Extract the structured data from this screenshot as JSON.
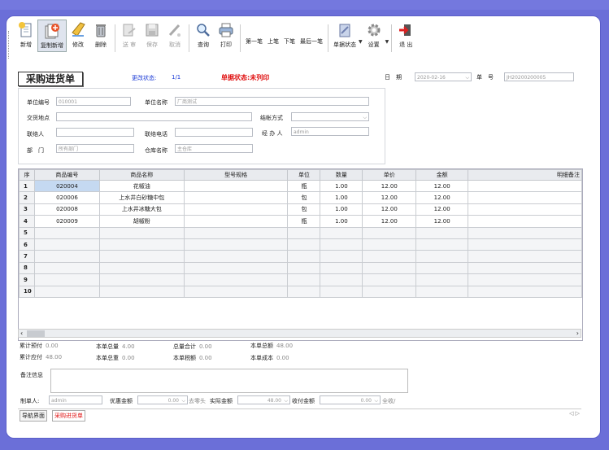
{
  "toolbar": {
    "new": "新增",
    "copy_new": "复制新增",
    "edit": "修改",
    "delete": "删除",
    "send_review": "送 审",
    "save": "保存",
    "cancel": "取消",
    "query": "查询",
    "print": "打印",
    "first": "第一笔",
    "prev": "上笔",
    "next": "下笔",
    "last": "最后一笔",
    "doc_status": "单据状态",
    "settings": "设置",
    "exit": "退 出"
  },
  "form": {
    "title": "采购进货单",
    "change_status_label": "更改状态:",
    "change_status_value": "1/1",
    "doc_status": "单据状态:未列印",
    "date_label": "日　期",
    "date_value": "2020-02-16",
    "number_label": "单　号",
    "number_value": "JH20200200005",
    "unit_code_label": "单位编号",
    "unit_code_value": "010001",
    "unit_name_label": "单位名称",
    "unit_name_value": "厂商测试",
    "delivery_label": "交货地点",
    "delivery_value": "",
    "settle_label": "结帐方式",
    "settle_value": "",
    "contact_label": "联络人",
    "contact_value": "",
    "phone_label": "联络电话",
    "phone_value": "",
    "handler_label": "经 办 人",
    "handler_value": "admin",
    "dept_label": "部　门",
    "dept_value": "所有部门",
    "warehouse_label": "仓库名称",
    "warehouse_value": "主仓库"
  },
  "grid": {
    "columns": [
      "序",
      "商品编号",
      "商品名称",
      "型号规格",
      "单位",
      "数量",
      "单价",
      "金额",
      "明细备注"
    ],
    "rows": [
      [
        "1",
        "020004",
        "花椒油",
        "",
        "瓶",
        "1.00",
        "12.00",
        "12.00",
        ""
      ],
      [
        "2",
        "020006",
        "上水井白砂糖中包",
        "",
        "包",
        "1.00",
        "12.00",
        "12.00",
        ""
      ],
      [
        "3",
        "020008",
        "上水井冰糖大包",
        "",
        "包",
        "1.00",
        "12.00",
        "12.00",
        ""
      ],
      [
        "4",
        "020009",
        "胡椒粉",
        "",
        "瓶",
        "1.00",
        "12.00",
        "12.00",
        ""
      ],
      [
        "5",
        "",
        "",
        "",
        "",
        "",
        "",
        "",
        ""
      ],
      [
        "6",
        "",
        "",
        "",
        "",
        "",
        "",
        "",
        ""
      ],
      [
        "7",
        "",
        "",
        "",
        "",
        "",
        "",
        "",
        ""
      ],
      [
        "8",
        "",
        "",
        "",
        "",
        "",
        "",
        "",
        ""
      ],
      [
        "9",
        "",
        "",
        "",
        "",
        "",
        "",
        "",
        ""
      ],
      [
        "10",
        "",
        "",
        "",
        "",
        "",
        "",
        "",
        ""
      ]
    ]
  },
  "summary": {
    "prepaid_label": "累计预付",
    "prepaid_value": "0.00",
    "total_qty_label": "本单总量",
    "total_qty_value": "4.00",
    "total_sum_label": "总量合计",
    "total_sum_value": "0.00",
    "total_amount_label": "本单总额",
    "total_amount_value": "48.00",
    "payable_label": "累计应付",
    "payable_value": "48.00",
    "total_weight_label": "本单总重",
    "total_weight_value": "0.00",
    "tax_label": "本单税额",
    "tax_value": "0.00",
    "cost_label": "本单成本",
    "cost_value": "0.00"
  },
  "footer": {
    "remark_label": "备注信息",
    "maker_label": "制单人:",
    "maker_value": "admin",
    "discount_label": "优惠金额",
    "discount_value": "0.00",
    "round_label": "去零头",
    "actual_label": "实际金额",
    "actual_value": "48.00",
    "received_label": "收付金额",
    "received_value": "0.00",
    "all_label": "全收/"
  },
  "tabs": {
    "nav": "导航界面",
    "purchase": "采购进货单"
  }
}
